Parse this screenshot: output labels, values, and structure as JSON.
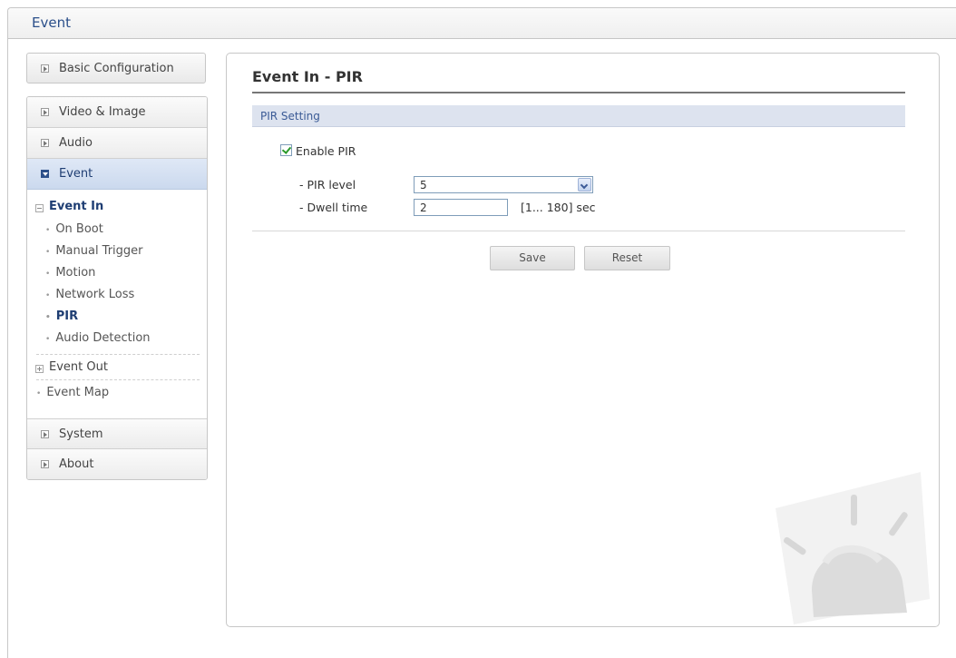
{
  "window": {
    "title": "Event"
  },
  "sidebar": {
    "basic_configuration": "Basic Configuration",
    "video_image": "Video & Image",
    "audio": "Audio",
    "event": "Event",
    "event_in": "Event In",
    "event_in_items": [
      "On Boot",
      "Manual Trigger",
      "Motion",
      "Network Loss",
      "PIR",
      "Audio Detection"
    ],
    "selected_item": "PIR",
    "event_out": "Event Out",
    "event_map": "Event Map",
    "system": "System",
    "about": "About"
  },
  "main": {
    "title": "Event In - PIR",
    "section": "PIR Setting",
    "enable_label": "Enable PIR",
    "enable_checked": true,
    "pir_level_label": "- PIR level",
    "pir_level_value": "5",
    "dwell_time_label": "- Dwell time",
    "dwell_time_value": "2",
    "dwell_time_range": "[1... 180] sec",
    "save_label": "Save",
    "reset_label": "Reset"
  },
  "icons": {
    "nav_arrow": "arrow-box-icon",
    "tree_collapse": "tree-minus-icon",
    "tree_expand": "tree-plus-icon",
    "watermark": "alarm-light-icon"
  },
  "colors": {
    "accent": "#2b4f8a",
    "active_nav": "#cbd9ee",
    "section_bg": "#dde3ef",
    "check": "#2a9a2a"
  }
}
